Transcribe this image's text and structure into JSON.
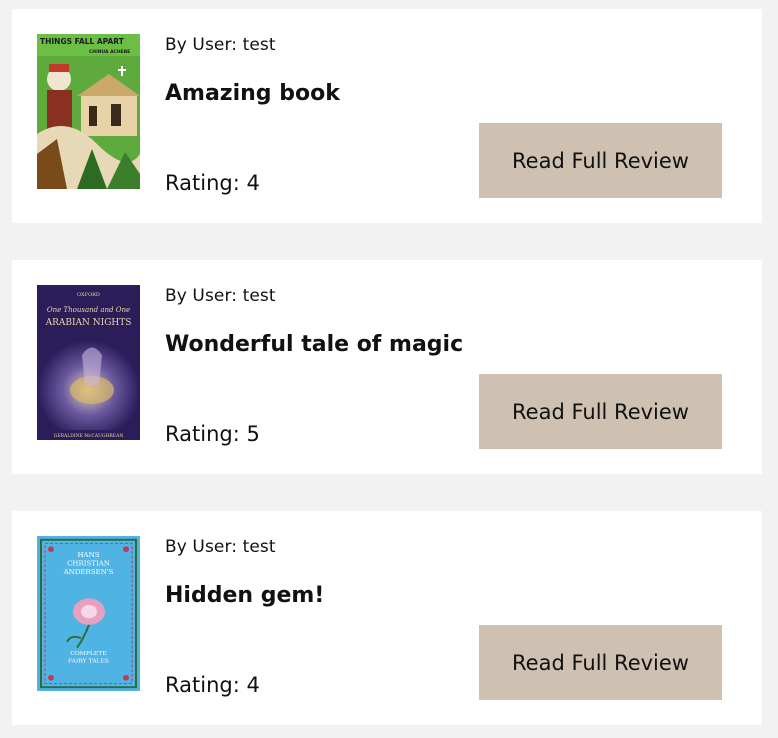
{
  "reviews": [
    {
      "byline": "By User: test",
      "title": "Amazing book",
      "rating": "Rating: 4",
      "button": "Read Full Review",
      "cover": {
        "top_text": "THINGS FALL APART",
        "author": "CHINUA ACHEBE",
        "icon": "book-cover-image"
      }
    },
    {
      "byline": "By User: test",
      "title": "Wonderful tale of magic",
      "rating": "Rating: 5",
      "button": "Read Full Review",
      "cover": {
        "top_text": "OXFORD",
        "subtitle": "One Thousand and One",
        "main_title": "ARABIAN NIGHTS",
        "author": "GERALDINE McCAUGHREAN",
        "icon": "book-cover-image"
      }
    },
    {
      "byline": "By User: test",
      "title": "Hidden gem!",
      "rating": "Rating: 4",
      "button": "Read Full Review",
      "cover": {
        "author_line1": "HANS",
        "author_line2": "CHRISTIAN",
        "author_line3": "ANDERSEN'S",
        "bottom_line1": "COMPLETE",
        "bottom_line2": "FAIRY TALES",
        "icon": "book-cover-image"
      }
    }
  ],
  "colors": {
    "page_background": "#f2f2f2",
    "card_background": "#ffffff",
    "button_background": "#cec1b1"
  }
}
